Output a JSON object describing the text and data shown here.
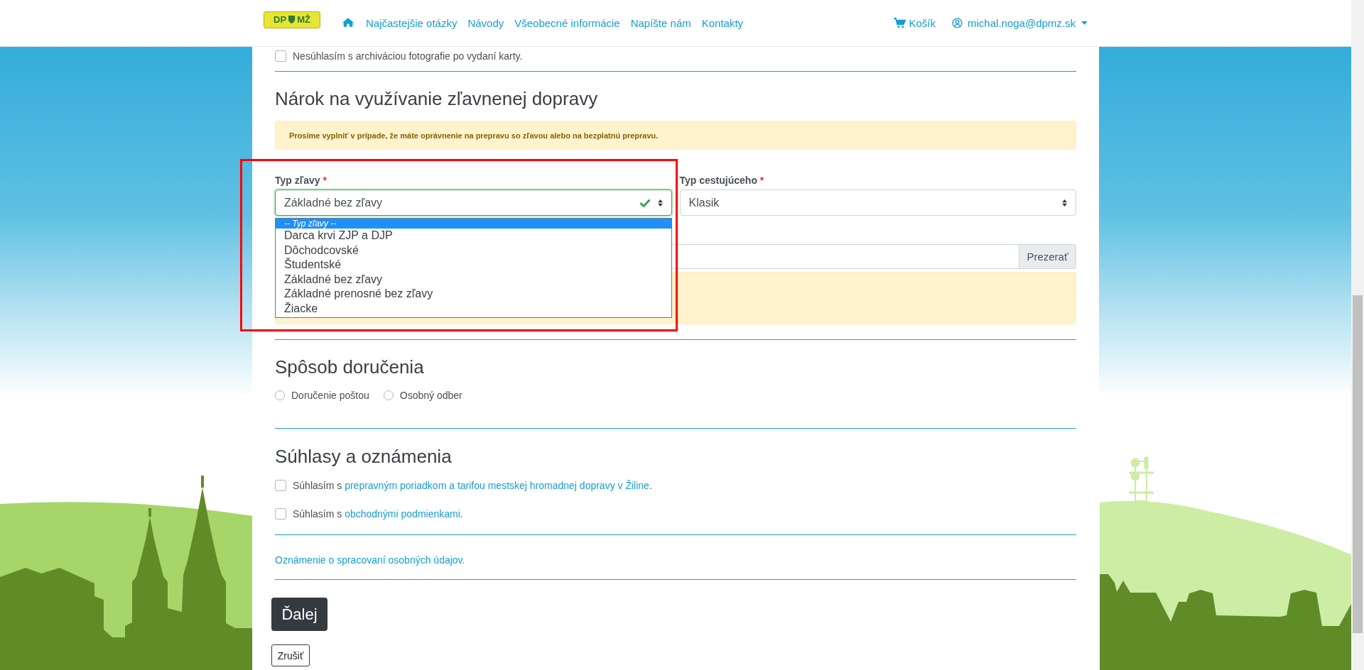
{
  "navbar": {
    "logo": {
      "left": "DP",
      "right": "MŽ"
    },
    "links": [
      {
        "label": "Najčastejšie otázky"
      },
      {
        "label": "Návody"
      },
      {
        "label": "Všeobecné informácie"
      },
      {
        "label": "Napíšte nám"
      },
      {
        "label": "Kontakty"
      }
    ],
    "cart": "Košík",
    "user": "michal.noga@dpmz.sk"
  },
  "archive_consent": {
    "label": "Nesúhlasím s archiváciou fotografie po vydaní karty.",
    "checked": false
  },
  "discount_section": {
    "title": "Nárok na využívanie zľavnenej dopravy",
    "notice": "Prosíme vyplniť v prípade, že máte oprávnenie na prepravu so zľavou alebo na bezplatnú prepravu.",
    "discount_type": {
      "label": "Typ zľavy",
      "required_mark": "*",
      "value": "Základné bez zľavy",
      "valid": true,
      "open": true,
      "options": [
        {
          "label": "-- Typ zľavy --",
          "highlighted": true
        },
        {
          "label": "Darca krvi ZJP a DJP",
          "highlighted": false
        },
        {
          "label": "Dôchodcovské",
          "highlighted": false
        },
        {
          "label": "Študentské",
          "highlighted": false
        },
        {
          "label": "Základné bez zľavy",
          "highlighted": false
        },
        {
          "label": "Základné prenosné bez zľavy",
          "highlighted": false
        },
        {
          "label": "Žiacke",
          "highlighted": false
        }
      ]
    },
    "traveler_type": {
      "label": "Typ cestujúceho",
      "required_mark": "*",
      "value": "Klasik"
    },
    "file_upload": {
      "button": "Prezerať"
    }
  },
  "delivery_section": {
    "title": "Spôsob doručenia",
    "options": [
      {
        "label": "Doručenie poštou",
        "selected": false
      },
      {
        "label": "Osobný odber",
        "selected": false
      }
    ]
  },
  "consents_section": {
    "title": "Súhlasy a oznámenia",
    "items": [
      {
        "prefix": "Súhlasím s",
        "link": "prepravným poriadkom a tarifou mestskej hromadnej dopravy v Žiline",
        "suffix": ".",
        "checked": false
      },
      {
        "prefix": "Súhlasím s",
        "link": "obchodnými podmienkami",
        "suffix": ".",
        "checked": false
      }
    ],
    "privacy_link": "Oznámenie o spracovaní osobných údajov."
  },
  "buttons": {
    "next": "Ďalej",
    "cancel": "Zrušiť"
  }
}
